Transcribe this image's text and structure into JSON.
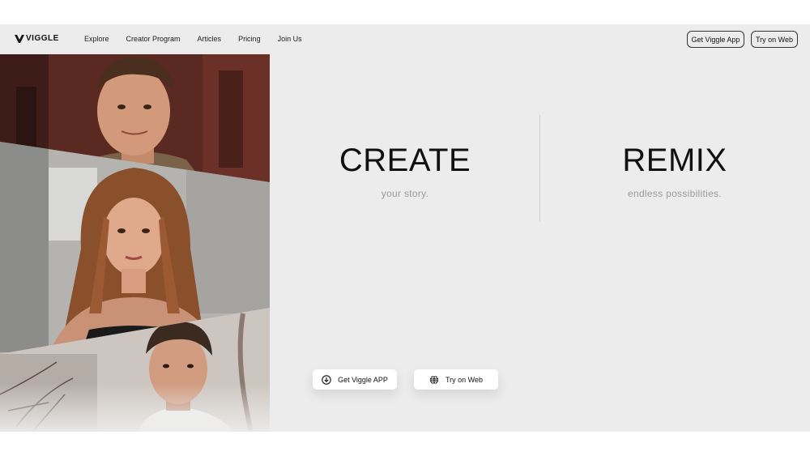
{
  "brand": {
    "logo_text": "VIGGLE"
  },
  "nav": {
    "links": [
      "Explore",
      "Creator Program",
      "Articles",
      "Pricing",
      "Join Us"
    ],
    "get_app_label": "Get Viggle App",
    "try_web_label": "Try on Web"
  },
  "hero": {
    "left": {
      "title": "CREATE",
      "subtitle": "your story."
    },
    "right": {
      "title": "REMIX",
      "subtitle": "endless possibilities."
    }
  },
  "cta": {
    "get_app_label": "Get Viggle APP",
    "try_web_label": "Try on Web"
  },
  "icons": {
    "logo": "viggle-v-icon",
    "download": "download-icon",
    "globe": "globe-icon"
  }
}
